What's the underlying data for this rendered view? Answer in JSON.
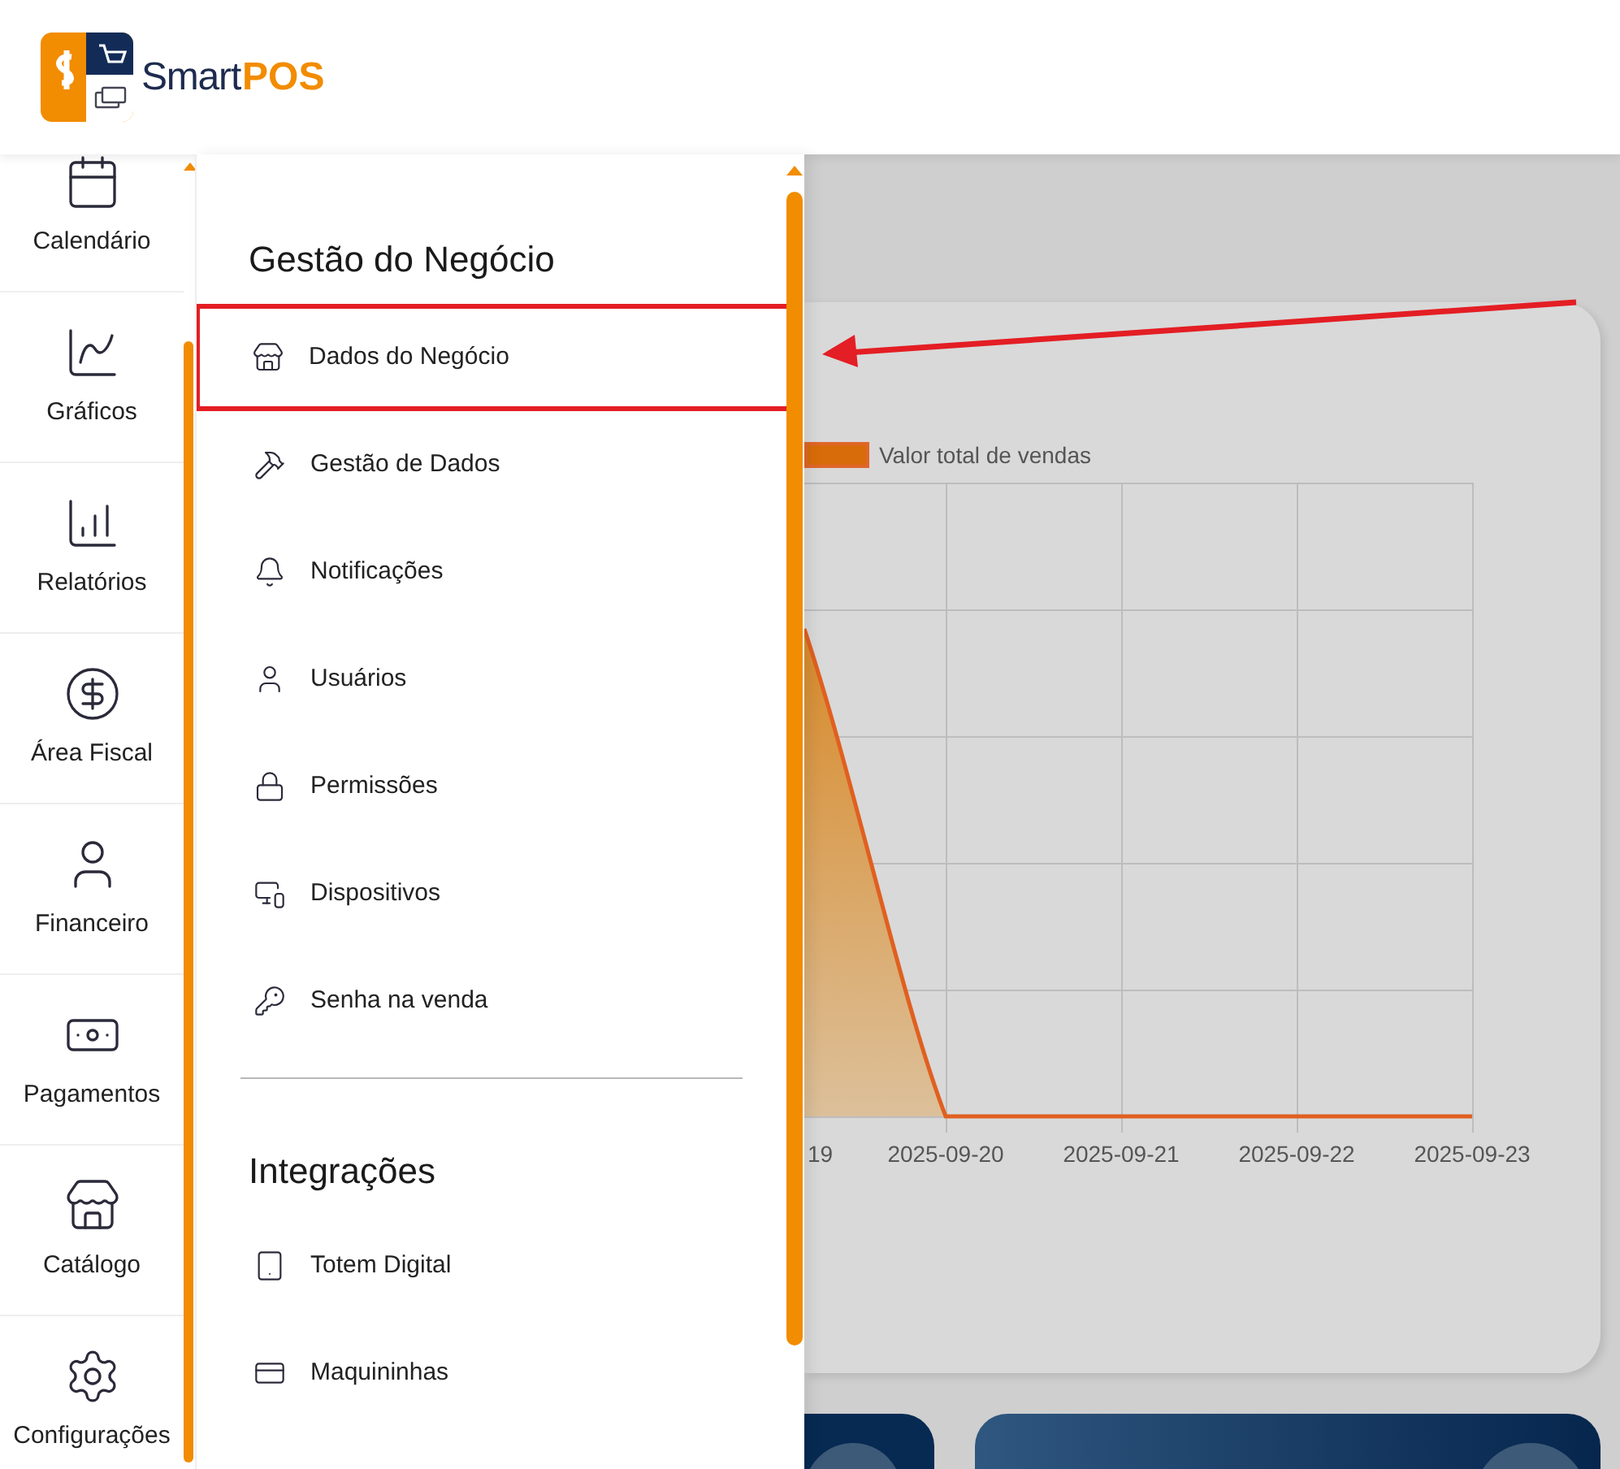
{
  "header": {
    "logo_text": "Smart",
    "logo_accent": "POS"
  },
  "rail": {
    "items": [
      {
        "label": "Calendário",
        "kind": "calendar"
      },
      {
        "label": "Gráficos",
        "kind": "line"
      },
      {
        "label": "Relatórios",
        "kind": "bars"
      },
      {
        "label": "Área Fiscal",
        "kind": "dollar"
      },
      {
        "label": "Financeiro",
        "kind": "user"
      },
      {
        "label": "Pagamentos",
        "kind": "banknote"
      },
      {
        "label": "Catálogo",
        "kind": "store"
      },
      {
        "label": "Configurações",
        "kind": "gear"
      }
    ]
  },
  "menu": {
    "sections": [
      {
        "title": "Gestão do Negócio",
        "items": [
          {
            "label": "Dados do Negócio",
            "kind": "store",
            "highlighted": true
          },
          {
            "label": "Gestão de Dados",
            "kind": "hammer",
            "highlighted": false
          },
          {
            "label": "Notificações",
            "kind": "bell",
            "highlighted": false
          },
          {
            "label": "Usuários",
            "kind": "user",
            "highlighted": false
          },
          {
            "label": "Permissões",
            "kind": "lock",
            "highlighted": false
          },
          {
            "label": "Dispositivos",
            "kind": "devices",
            "highlighted": false
          },
          {
            "label": "Senha na venda",
            "kind": "key",
            "highlighted": false
          }
        ]
      },
      {
        "title": "Integrações",
        "items": [
          {
            "label": "Totem Digital",
            "kind": "tablet",
            "highlighted": false
          },
          {
            "label": "Maquininhas",
            "kind": "card",
            "highlighted": false
          }
        ]
      }
    ]
  },
  "chart": {
    "legend": "Valor total de vendas",
    "x_labels": [
      "19",
      "2025-09-20",
      "2025-09-21",
      "2025-09-22",
      "2025-09-23"
    ]
  }
}
